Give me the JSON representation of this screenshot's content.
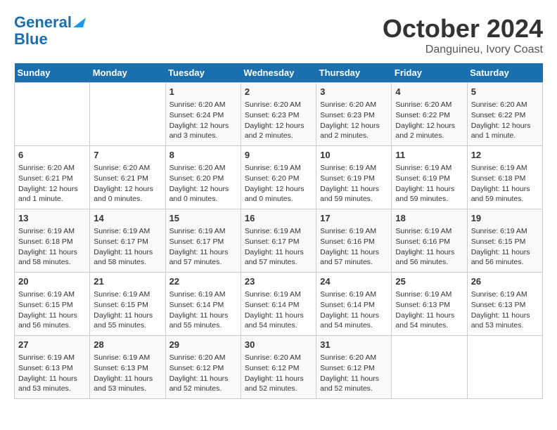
{
  "logo": {
    "line1": "General",
    "line2": "Blue"
  },
  "title": "October 2024",
  "subtitle": "Danguineu, Ivory Coast",
  "days_of_week": [
    "Sunday",
    "Monday",
    "Tuesday",
    "Wednesday",
    "Thursday",
    "Friday",
    "Saturday"
  ],
  "weeks": [
    [
      {
        "day": "",
        "data": ""
      },
      {
        "day": "",
        "data": ""
      },
      {
        "day": "1",
        "data": "Sunrise: 6:20 AM\nSunset: 6:24 PM\nDaylight: 12 hours and 3 minutes."
      },
      {
        "day": "2",
        "data": "Sunrise: 6:20 AM\nSunset: 6:23 PM\nDaylight: 12 hours and 2 minutes."
      },
      {
        "day": "3",
        "data": "Sunrise: 6:20 AM\nSunset: 6:23 PM\nDaylight: 12 hours and 2 minutes."
      },
      {
        "day": "4",
        "data": "Sunrise: 6:20 AM\nSunset: 6:22 PM\nDaylight: 12 hours and 2 minutes."
      },
      {
        "day": "5",
        "data": "Sunrise: 6:20 AM\nSunset: 6:22 PM\nDaylight: 12 hours and 1 minute."
      }
    ],
    [
      {
        "day": "6",
        "data": "Sunrise: 6:20 AM\nSunset: 6:21 PM\nDaylight: 12 hours and 1 minute."
      },
      {
        "day": "7",
        "data": "Sunrise: 6:20 AM\nSunset: 6:21 PM\nDaylight: 12 hours and 0 minutes."
      },
      {
        "day": "8",
        "data": "Sunrise: 6:20 AM\nSunset: 6:20 PM\nDaylight: 12 hours and 0 minutes."
      },
      {
        "day": "9",
        "data": "Sunrise: 6:19 AM\nSunset: 6:20 PM\nDaylight: 12 hours and 0 minutes."
      },
      {
        "day": "10",
        "data": "Sunrise: 6:19 AM\nSunset: 6:19 PM\nDaylight: 11 hours and 59 minutes."
      },
      {
        "day": "11",
        "data": "Sunrise: 6:19 AM\nSunset: 6:19 PM\nDaylight: 11 hours and 59 minutes."
      },
      {
        "day": "12",
        "data": "Sunrise: 6:19 AM\nSunset: 6:18 PM\nDaylight: 11 hours and 59 minutes."
      }
    ],
    [
      {
        "day": "13",
        "data": "Sunrise: 6:19 AM\nSunset: 6:18 PM\nDaylight: 11 hours and 58 minutes."
      },
      {
        "day": "14",
        "data": "Sunrise: 6:19 AM\nSunset: 6:17 PM\nDaylight: 11 hours and 58 minutes."
      },
      {
        "day": "15",
        "data": "Sunrise: 6:19 AM\nSunset: 6:17 PM\nDaylight: 11 hours and 57 minutes."
      },
      {
        "day": "16",
        "data": "Sunrise: 6:19 AM\nSunset: 6:17 PM\nDaylight: 11 hours and 57 minutes."
      },
      {
        "day": "17",
        "data": "Sunrise: 6:19 AM\nSunset: 6:16 PM\nDaylight: 11 hours and 57 minutes."
      },
      {
        "day": "18",
        "data": "Sunrise: 6:19 AM\nSunset: 6:16 PM\nDaylight: 11 hours and 56 minutes."
      },
      {
        "day": "19",
        "data": "Sunrise: 6:19 AM\nSunset: 6:15 PM\nDaylight: 11 hours and 56 minutes."
      }
    ],
    [
      {
        "day": "20",
        "data": "Sunrise: 6:19 AM\nSunset: 6:15 PM\nDaylight: 11 hours and 56 minutes."
      },
      {
        "day": "21",
        "data": "Sunrise: 6:19 AM\nSunset: 6:15 PM\nDaylight: 11 hours and 55 minutes."
      },
      {
        "day": "22",
        "data": "Sunrise: 6:19 AM\nSunset: 6:14 PM\nDaylight: 11 hours and 55 minutes."
      },
      {
        "day": "23",
        "data": "Sunrise: 6:19 AM\nSunset: 6:14 PM\nDaylight: 11 hours and 54 minutes."
      },
      {
        "day": "24",
        "data": "Sunrise: 6:19 AM\nSunset: 6:14 PM\nDaylight: 11 hours and 54 minutes."
      },
      {
        "day": "25",
        "data": "Sunrise: 6:19 AM\nSunset: 6:13 PM\nDaylight: 11 hours and 54 minutes."
      },
      {
        "day": "26",
        "data": "Sunrise: 6:19 AM\nSunset: 6:13 PM\nDaylight: 11 hours and 53 minutes."
      }
    ],
    [
      {
        "day": "27",
        "data": "Sunrise: 6:19 AM\nSunset: 6:13 PM\nDaylight: 11 hours and 53 minutes."
      },
      {
        "day": "28",
        "data": "Sunrise: 6:19 AM\nSunset: 6:13 PM\nDaylight: 11 hours and 53 minutes."
      },
      {
        "day": "29",
        "data": "Sunrise: 6:20 AM\nSunset: 6:12 PM\nDaylight: 11 hours and 52 minutes."
      },
      {
        "day": "30",
        "data": "Sunrise: 6:20 AM\nSunset: 6:12 PM\nDaylight: 11 hours and 52 minutes."
      },
      {
        "day": "31",
        "data": "Sunrise: 6:20 AM\nSunset: 6:12 PM\nDaylight: 11 hours and 52 minutes."
      },
      {
        "day": "",
        "data": ""
      },
      {
        "day": "",
        "data": ""
      }
    ]
  ]
}
